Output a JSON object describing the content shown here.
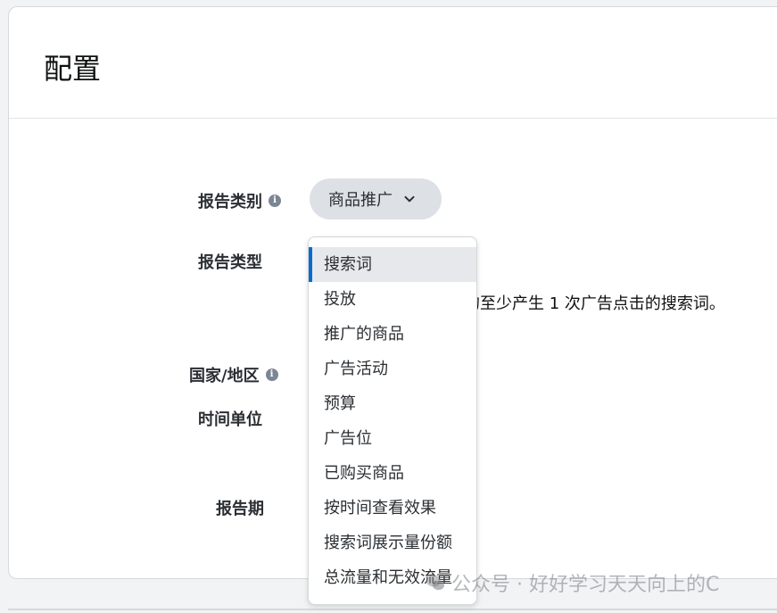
{
  "card": {
    "title": "配置"
  },
  "form": {
    "report_category_label": "报告类别",
    "report_type_label": "报告类型",
    "country_label": "国家/地区",
    "time_unit_label": "时间单位",
    "report_period_label": "报告期",
    "category_value": "商品推广",
    "report_type_description": "的至少产生 1 次广告点击的搜索词。"
  },
  "dropdown": {
    "selected": "搜索词",
    "items": [
      "搜索词",
      "投放",
      "推广的商品",
      "广告活动",
      "预算",
      "广告位",
      "已购买商品",
      "按时间查看效果",
      "搜索词展示量份额",
      "总流量和无效流量"
    ]
  },
  "watermark": {
    "text": "公众号 · 好好学习天天向上的C"
  },
  "colors": {
    "accent": "#0b6bcb",
    "button_bg": "#dde1e6",
    "text": "#2b2f33"
  }
}
